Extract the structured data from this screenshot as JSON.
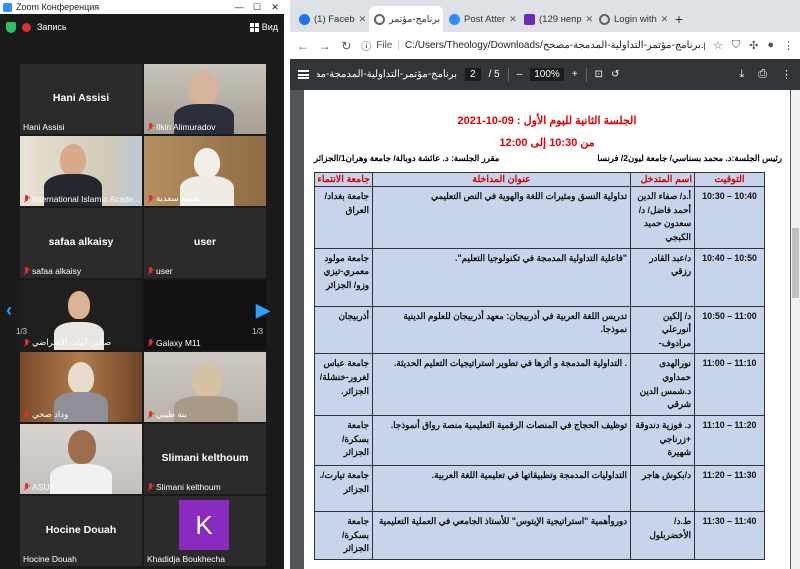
{
  "zoom": {
    "title": "Zoom Конференция",
    "record_label": "Запись",
    "view_label": "Вид",
    "page_left": "1/3",
    "page_right": "1/3",
    "tiles": [
      {
        "big": "Hani Assisi",
        "label": "Hani Assisi",
        "muted": false
      },
      {
        "big": "",
        "label": "Ilkin Alimuradov",
        "muted": true
      },
      {
        "big": "",
        "label": "International Islamic Acade...",
        "muted": true
      },
      {
        "big": "",
        "label": "نعيمة سعدية",
        "muted": true
      },
      {
        "big": "safaa alkaisy",
        "label": "safaa alkaisy",
        "muted": true
      },
      {
        "big": "user",
        "label": "user",
        "muted": true
      },
      {
        "big": "",
        "label": "صالين أبيات الافتراضي",
        "muted": true
      },
      {
        "big": "",
        "label": "Galaxy M11",
        "muted": true
      },
      {
        "big": "",
        "label": "وداد صحي",
        "muted": true
      },
      {
        "big": "",
        "label": "بنة طيبي",
        "muted": true
      },
      {
        "big": "",
        "label": "ASUS",
        "muted": true
      },
      {
        "big": "Slimani kelthoum",
        "label": "Slimani kelthoum",
        "muted": true
      },
      {
        "big": "Hocine Douah",
        "label": "Hocine Douah",
        "muted": false
      },
      {
        "big": "K",
        "label": "Khadidja Boukhecha",
        "muted": false
      }
    ]
  },
  "browser": {
    "tabs": [
      {
        "label": "(1) Faceb",
        "icon": "facebook-icon",
        "color": "#1877f2"
      },
      {
        "label": "برنامج-مؤتمر",
        "icon": "globe-icon",
        "color": "#5f6368"
      },
      {
        "label": "Post Atter",
        "icon": "zoom-icon",
        "color": "#2d8cff"
      },
      {
        "label": "(129 непр",
        "icon": "mail-icon",
        "color": "#6b2bb3"
      },
      {
        "label": "Login with",
        "icon": "globe-icon",
        "color": "#5f6368"
      }
    ],
    "new_tab": "+",
    "address_label": "File",
    "url": "C:/Users/Theology/Downloads/برنامج-مؤتمر-التداولية-المدمجة-مصحح.pdf"
  },
  "pdf": {
    "file_name": "برنامج-مؤتمر-التداولية-المدمجة-مصحح",
    "page_current": "2",
    "page_total": "/ 5",
    "zoom": "100%",
    "zoom_out": "–",
    "zoom_in": "+",
    "session_title": "الجلسة الثانية لليوم الأول : 09-10-2021",
    "session_time": "من 10:30 إلى 12:00",
    "chair": "رئيس الجلسة:د. محمد بسناسي/ جامعة ليون2/ فرنسا",
    "reporter": "مقرر الجلسة: د. عائشة دوبالة/ جامعة وهران1/الجزائر",
    "headers": {
      "time": "التوقيت",
      "speaker": "اسم المتدخل",
      "title": "عنوان المداخلة",
      "affiliation": "جامعة الانتماء"
    },
    "rows": [
      {
        "time": "10:30 – 10:40",
        "speaker": "أ.د/ صفاء الدين أحمد فاضل/ د/ سعدون حميد الكبجي",
        "title": "تداولية النسق ومثيرات اللغة والهوية في النص التعليمي",
        "affiliation": "جامعة بغداد/ العراق"
      },
      {
        "time": "10:40 – 10:50",
        "speaker": "د/عبد القادر رزقي",
        "title": "\"فاعلية التداولية المدمجة في تكنولوجيا التعليم\".",
        "affiliation": "جامعة مولود معمري-تيزي وزو/ الجزائر"
      },
      {
        "time": "10:50 – 11:00",
        "speaker": "د/ إلكين أنورعلي مرادوف-",
        "title": "تدريس اللغة العربية في أذربيجان: معهد أذربيجان للعلوم الدينية نموذجا.",
        "affiliation": "أذربيجان"
      },
      {
        "time": "11:00 – 11:10",
        "speaker": "نورالهدى حمداوي د.شمس الدين شرقي",
        "title": ". التداولية المدمجة و أثرها في تطوير استراتيجيات التعليم الحديثة.",
        "affiliation": "جامعة عباس لغرور-خنشلة/ الجزائر."
      },
      {
        "time": "11:10 – 11:20",
        "speaker": "د. فوزية دندوقة +زرناجي شهيرة",
        "title": "توظيف الحجاج في المنصات الرقمية التعليمية منصة رواق أنموذجا.",
        "affiliation": "جامعة بسكرة/ الجزائر"
      },
      {
        "time": "11:20 – 11:30",
        "speaker": "د/بكوش هاجر",
        "title": "التداوليات المدمجة وتطبيقاتها في تعليمية اللغة العربية.",
        "affiliation": "جامعة تيارت/. الجزائر"
      },
      {
        "time": "11:30 – 11:40",
        "speaker": "ط.د/الأخضربلول",
        "title": "دوروأهمية \"استراتيجية الإيتوس\" للأستاذ الجامعي في العملية التعليمية",
        "affiliation": "جامعة بسكرة/ الجزائر"
      }
    ]
  }
}
